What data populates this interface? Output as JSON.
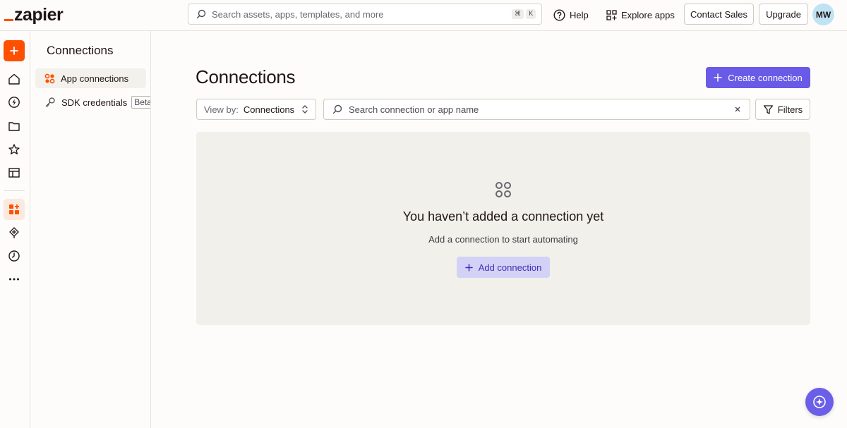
{
  "brand": {
    "name": "zapier",
    "accent": "#ff4f00"
  },
  "header": {
    "search_placeholder": "Search assets, apps, templates, and more",
    "shortcut_key1": "⌘",
    "shortcut_key2": "K",
    "help_label": "Help",
    "explore_label": "Explore apps",
    "contact_sales_label": "Contact Sales",
    "upgrade_label": "Upgrade",
    "avatar_initials": "MW"
  },
  "rail": {
    "icons": [
      "plus-icon",
      "home-icon",
      "zap-icon",
      "folder-icon",
      "star-icon",
      "table-icon",
      "apps-icon",
      "canvas-icon",
      "history-icon",
      "more-icon"
    ]
  },
  "subnav": {
    "title": "Connections",
    "items": [
      {
        "label": "App connections",
        "active": true
      },
      {
        "label": "SDK credentials",
        "badge": "Beta",
        "active": false
      }
    ]
  },
  "main": {
    "title": "Connections",
    "create_label": "Create connection",
    "view_by_key": "View by:",
    "view_by_value": "Connections",
    "search_placeholder": "Search connection or app name",
    "filters_label": "Filters",
    "empty": {
      "title": "You haven’t added a connection yet",
      "subtitle": "Add a connection to start automating",
      "add_label": "Add connection"
    }
  },
  "colors": {
    "primary": "#695be8",
    "empty_bg": "#f1f0ea",
    "add_button_bg": "#d4d1f6"
  }
}
